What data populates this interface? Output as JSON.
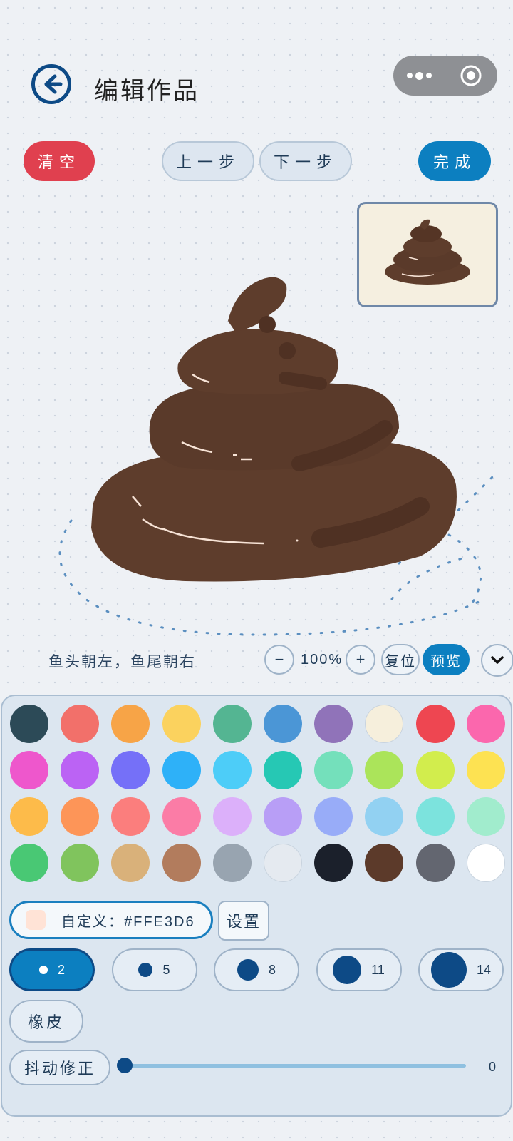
{
  "header": {
    "title": "编辑作品",
    "back_icon": "arrow-left-circle-icon",
    "menu_icon": "more-dots-icon",
    "close_icon": "target-circle-icon"
  },
  "toolbar": {
    "clear_label": "清空",
    "undo_label": "上一步",
    "redo_label": "下一步",
    "done_label": "完成"
  },
  "canvas": {
    "hint": "鱼头朝左，鱼尾朝右",
    "zoom_minus": "−",
    "zoom_value": "100%",
    "zoom_plus": "+",
    "reset_label": "复位",
    "preview_label": "预览",
    "collapse_icon": "chevron-down-icon"
  },
  "palette": {
    "colors": [
      "#2c4a57",
      "#f2706a",
      "#f7a447",
      "#fbd25e",
      "#54b592",
      "#4b96d6",
      "#9073b9",
      "#f6efdc",
      "#ee4651",
      "#fb67ad",
      "#ee57cc",
      "#bb63f4",
      "#7570f8",
      "#2eb1f8",
      "#4dcdf8",
      "#26c8b4",
      "#74e0bb",
      "#abe45a",
      "#d2ed4d",
      "#fde252",
      "#fdbb4a",
      "#fd9558",
      "#fb7e7d",
      "#fb7ca6",
      "#dcb0fa",
      "#b89ef6",
      "#98acf8",
      "#92d1f2",
      "#7ce3dd",
      "#a1eccd",
      "#49c874",
      "#80c45d",
      "#d9b17a",
      "#b27c5d",
      "#98a4b0",
      "#e5eaf0",
      "#1b202b",
      "#5c3a2a",
      "#636670",
      "#ffffff"
    ],
    "custom_label": "自定义：#FFE3D6",
    "custom_color": "#ffe3d6",
    "set_label": "设置"
  },
  "brushes": {
    "sizes": [
      "2",
      "5",
      "8",
      "11",
      "14"
    ],
    "selected": "2",
    "eraser_label": "橡皮",
    "stabilizer_label": "抖动修正",
    "stabilizer_value": "0"
  },
  "colors": {
    "accent": "#0c7fc0",
    "danger": "#e0404f",
    "brown": "#5e3d2c"
  }
}
